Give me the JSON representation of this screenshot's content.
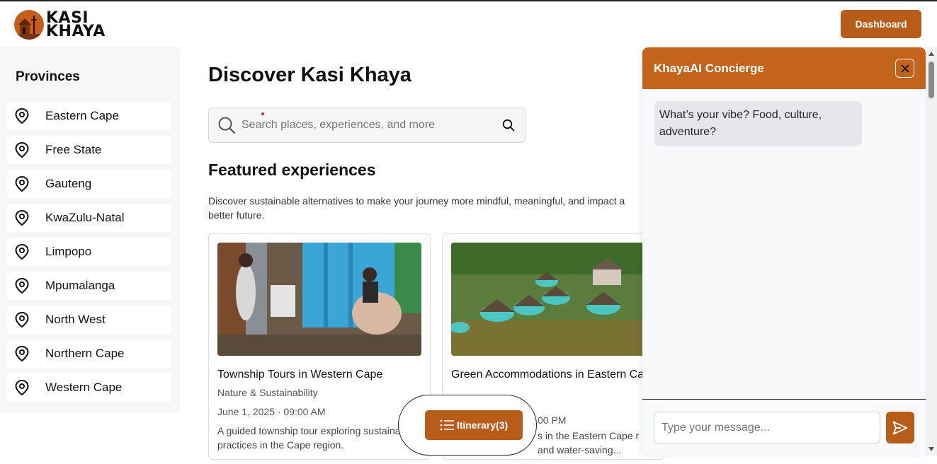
{
  "header": {
    "logo_line1": "KASI",
    "logo_line2": "KHAYA",
    "dashboard_label": "Dashboard"
  },
  "sidebar": {
    "title": "Provinces",
    "items": [
      {
        "label": "Eastern Cape",
        "icon": "map-pin-icon"
      },
      {
        "label": "Free State",
        "icon": "map-pin-icon"
      },
      {
        "label": "Gauteng",
        "icon": "map-pin-icon"
      },
      {
        "label": "KwaZulu-Natal",
        "icon": "map-pin-icon"
      },
      {
        "label": "Limpopo",
        "icon": "map-pin-icon"
      },
      {
        "label": "Mpumalanga",
        "icon": "map-pin-icon"
      },
      {
        "label": "North West",
        "icon": "map-pin-icon"
      },
      {
        "label": "Northern Cape",
        "icon": "map-pin-icon"
      },
      {
        "label": "Western Cape",
        "icon": "map-pin-icon"
      }
    ]
  },
  "main": {
    "title": "Discover Kasi Khaya",
    "search_placeholder": "Search places, experiences, and more",
    "section_title": "Featured experiences",
    "section_desc": "Discover sustainable alternatives to make your journey more mindful, meaningful, and impact a better future.",
    "cards": [
      {
        "title": "Township Tours in Western Cape",
        "category": "Nature & Sustainability",
        "date": "June 1, 2025 · 09:00 AM",
        "desc": "A guided township tour exploring sustainable practices in the Cape region."
      },
      {
        "title": "Green Accommodations in Eastern Cape",
        "category": "",
        "date": "00 PM",
        "desc": "s in the Eastern Cape r and water-saving..."
      }
    ]
  },
  "itinerary": {
    "label": "Itinerary(3)"
  },
  "chat": {
    "title": "KhayaAI Concierge",
    "message": "What’s your vibe? Food, culture, adventure?",
    "input_placeholder": "Type your message..."
  },
  "colors": {
    "brand": "#b85c1a",
    "chat_header": "#c4641c",
    "sidebar_bg": "#f7f7f7"
  }
}
